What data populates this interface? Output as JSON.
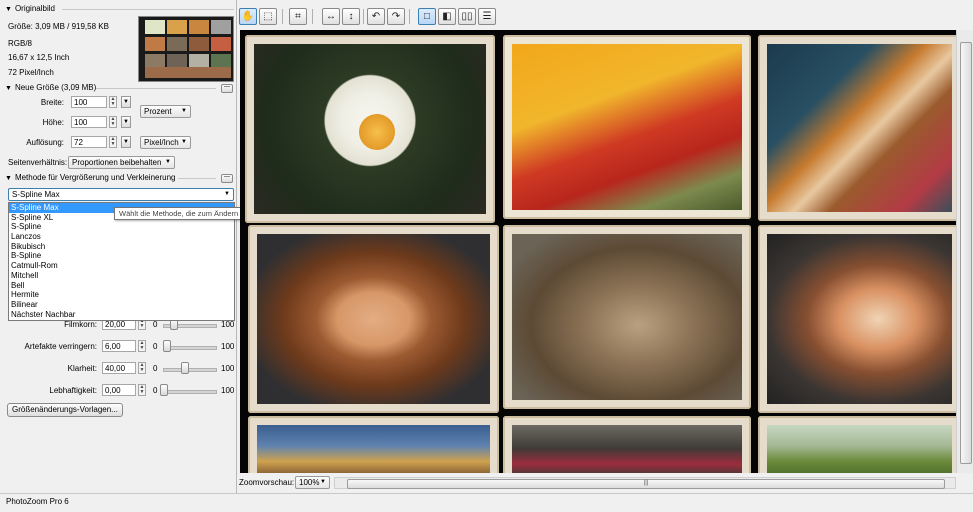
{
  "app": {
    "status_title": "PhotoZoom Pro 6"
  },
  "original": {
    "section_title": "Originalbild",
    "size": "Größe: 3,09 MB / 919,58 KB",
    "mode": "RGB/8",
    "dims": "16,67 x 12,5 Inch",
    "resolution": "72 Pixel/Inch"
  },
  "new_size": {
    "section_title": "Neue Größe (3,09 MB)",
    "width_label": "Breite:",
    "width_value": "100",
    "height_label": "Höhe:",
    "height_value": "100",
    "res_label": "Auflösung:",
    "res_value": "72",
    "unit_select": "Prozent",
    "res_unit_select": "Pixel/Inch",
    "aspect_label": "Seitenverhältnis:",
    "aspect_select": "Proportionen beibehalten"
  },
  "method": {
    "section_title": "Methode für Vergrößerung und Verkleinerung",
    "selected": "S-Spline Max",
    "options": [
      "S-Spline Max",
      "S-Spline XL",
      "S-Spline",
      "Lanczos",
      "Bikubisch",
      "B-Spline",
      "Catmull-Rom",
      "Mitchell",
      "Bell",
      "Hermite",
      "Bilinear",
      "Nächster Nachbar"
    ],
    "tooltip": "Wählt die Methode, die zum Ändern der Bildgröße verwendet wird"
  },
  "sliders": [
    {
      "label": "Filmkorn:",
      "value": "20,00",
      "min": "0",
      "max": "100",
      "level": 0.2
    },
    {
      "label": "Artefakte verringern:",
      "value": "6,00",
      "min": "0",
      "max": "100",
      "level": 0.06
    },
    {
      "label": "Klarheit:",
      "value": "40,00",
      "min": "0",
      "max": "100",
      "level": 0.4
    },
    {
      "label": "Lebhaftigkeit:",
      "value": "0,00",
      "min": "0",
      "max": "100",
      "level": 0.0
    }
  ],
  "presets_button": "Größenänderungs-Vorlagen...",
  "toolbar": {
    "icons": [
      "hand-icon",
      "selection-icon",
      "crop-icon",
      "fit-width-icon",
      "fit-height-icon",
      "rotate-left-icon",
      "rotate-right-icon",
      "single-view-icon",
      "split-view-icon",
      "side-by-side-icon",
      "stacked-view-icon"
    ]
  },
  "zoom": {
    "label": "Zoomvorschau:",
    "value": "100%"
  },
  "ui_glyphs": {
    "section_triangle": "▼",
    "collapse": "—",
    "arrow_down": "▼",
    "arrow_up": "▲",
    "grip": "|||"
  }
}
